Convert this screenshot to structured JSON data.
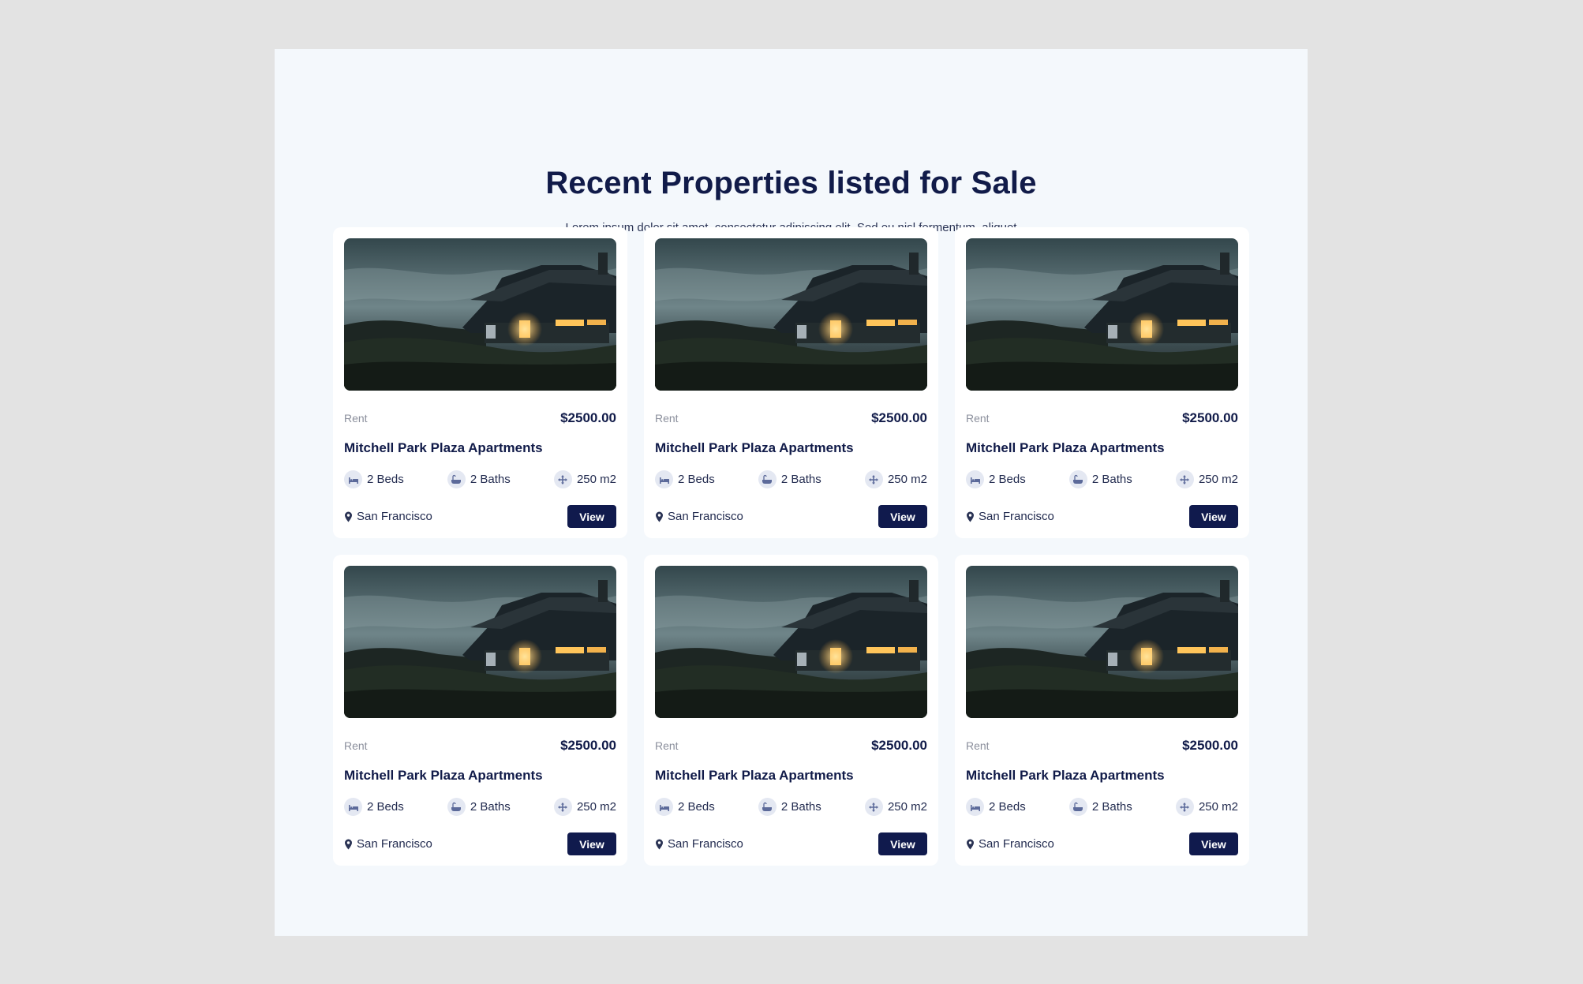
{
  "section": {
    "title": "Recent Properties listed for Sale",
    "intro": "Lorem ipsum dolor sit amet, consectetur adipiscing elit. Sed eu nisl fermentum, aliquet lectus vel, pulvinar tortor. Sed sit amet aliquet elit."
  },
  "listings": [
    {
      "type": "Rent",
      "price": "$2500.00",
      "title": "Mitchell Park Plaza Apartments",
      "beds": "2 Beds",
      "baths": "2 Baths",
      "area": "250 m2",
      "location": "San Francisco",
      "button": "View"
    },
    {
      "type": "Rent",
      "price": "$2500.00",
      "title": "Mitchell Park Plaza Apartments",
      "beds": "2 Beds",
      "baths": "2 Baths",
      "area": "250 m2",
      "location": "San Francisco",
      "button": "View"
    },
    {
      "type": "Rent",
      "price": "$2500.00",
      "title": "Mitchell Park Plaza Apartments",
      "beds": "2 Beds",
      "baths": "2 Baths",
      "area": "250 m2",
      "location": "San Francisco",
      "button": "View"
    },
    {
      "type": "Rent",
      "price": "$2500.00",
      "title": "Mitchell Park Plaza Apartments",
      "beds": "2 Beds",
      "baths": "2 Baths",
      "area": "250 m2",
      "location": "San Francisco",
      "button": "View"
    },
    {
      "type": "Rent",
      "price": "$2500.00",
      "title": "Mitchell Park Plaza Apartments",
      "beds": "2 Beds",
      "baths": "2 Baths",
      "area": "250 m2",
      "location": "San Francisco",
      "button": "View"
    },
    {
      "type": "Rent",
      "price": "$2500.00",
      "title": "Mitchell Park Plaza Apartments",
      "beds": "2 Beds",
      "baths": "2 Baths",
      "area": "250 m2",
      "location": "San Francisco",
      "button": "View"
    }
  ],
  "icons": {
    "beds": "bed-icon",
    "baths": "bathtub-icon",
    "area": "area-arrows-icon",
    "location": "map-pin-icon",
    "photo": "house-photo"
  },
  "colors": {
    "navy": "#101a4d",
    "page_background": "#e3e3e3",
    "section_background": "#f4f8fc",
    "card_background": "#ffffff",
    "muted_text": "#8b8f9c"
  }
}
